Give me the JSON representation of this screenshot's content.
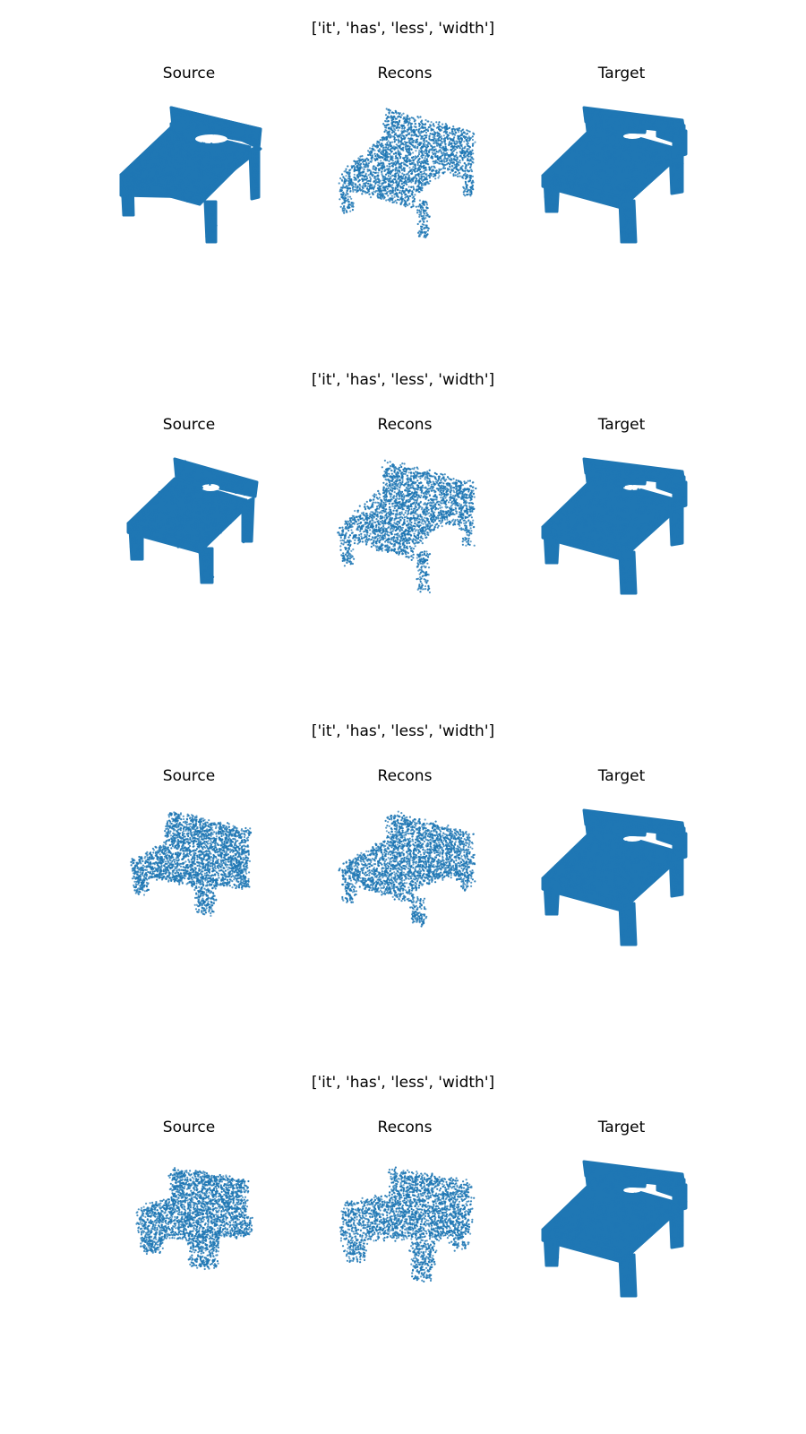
{
  "point_color": "#1f77b4",
  "rows": [
    {
      "title": "['it', 'has', 'less', 'width']",
      "source_label": "Source",
      "recons_label": "Recons",
      "target_label": "Target"
    },
    {
      "title": "['it', 'has', 'less', 'width']",
      "source_label": "Source",
      "recons_label": "Recons",
      "target_label": "Target"
    },
    {
      "title": "['it', 'has', 'less', 'width']",
      "source_label": "Source",
      "recons_label": "Recons",
      "target_label": "Target"
    },
    {
      "title": "['it', 'has', 'less', 'width']",
      "source_label": "Source",
      "recons_label": "Recons",
      "target_label": "Target"
    }
  ]
}
